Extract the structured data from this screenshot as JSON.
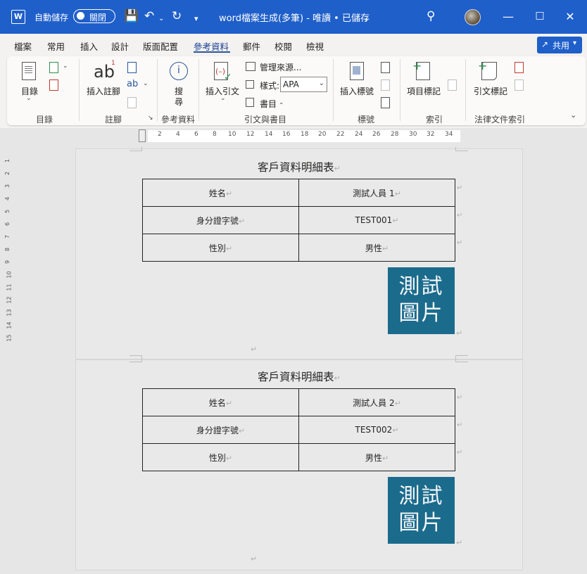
{
  "titlebar": {
    "autosave_label": "自動儲存",
    "autosave_state": "關閉",
    "doc_title": "word檔案生成(多筆) - 唯讀 • 已儲存",
    "colors": {
      "bar": "#1f5fc9"
    }
  },
  "menu": {
    "tabs": [
      "檔案",
      "常用",
      "插入",
      "設計",
      "版面配置",
      "參考資料",
      "郵件",
      "校閱",
      "檢視"
    ],
    "active_tab": "參考資料",
    "share_label": "共用"
  },
  "ribbon": {
    "toc_label": "目錄",
    "insert_footnote_label": "插入註腳",
    "search_label_top": "搜",
    "search_label_bottom": "尋",
    "insert_citation_label": "插入引文",
    "manage_sources_label": "管理來源...",
    "style_label": "樣式:",
    "style_value": "APA",
    "bibliography_label": "書目",
    "insert_caption_label": "插入標號",
    "mark_entry_label": "項目標記",
    "mark_citation_label": "引文標記",
    "groups": {
      "toc": "目錄",
      "footnotes": "註腳",
      "research": "參考資料",
      "citations": "引文與書目",
      "captions": "標號",
      "index": "索引",
      "authorities": "法律文件索引"
    }
  },
  "ruler": {
    "ticks": [
      "2",
      "4",
      "6",
      "8",
      "10",
      "12",
      "14",
      "16",
      "18",
      "20",
      "22",
      "24",
      "26",
      "28",
      "30",
      "32",
      "34"
    ],
    "vticks": [
      "1",
      "2",
      "3",
      "4",
      "5",
      "6",
      "7",
      "8",
      "9",
      "10",
      "11",
      "12",
      "13",
      "14",
      "15"
    ]
  },
  "records": [
    {
      "title": "客戶資料明細表",
      "rows": [
        {
          "label": "姓名",
          "value": "測試人員 1"
        },
        {
          "label": "身分證字號",
          "value": "TEST001"
        },
        {
          "label": "性別",
          "value": "男性"
        }
      ],
      "photo_line1": "測試",
      "photo_line2": "圖片"
    },
    {
      "title": "客戶資料明細表",
      "rows": [
        {
          "label": "姓名",
          "value": "測試人員 2"
        },
        {
          "label": "身分證字號",
          "value": "TEST002"
        },
        {
          "label": "性別",
          "value": "男性"
        }
      ],
      "photo_line1": "測試",
      "photo_line2": "圖片"
    }
  ],
  "marks": {
    "para": "↵"
  }
}
